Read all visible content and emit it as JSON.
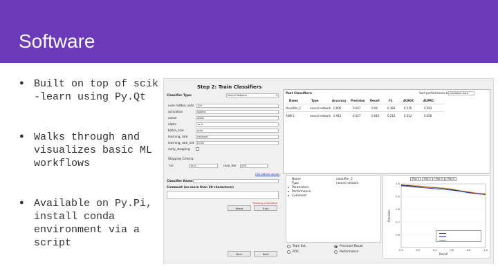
{
  "slide": {
    "title": "Software",
    "bullets": [
      "Built on top of scik\n-learn using Py.Qt",
      "Walks through and\nvisualizes basic ML\nworkflows",
      "Available on Py.Pi,\ninstall conda\nenvironment via a\nscript"
    ]
  },
  "app": {
    "step_title": "Step 2: Train Classifiers",
    "classifier_type_label": "Classifier Type:",
    "classifier_type_value": "Neural Network",
    "params": [
      {
        "label": "num hidden units",
        "value": "100"
      },
      {
        "label": "activation",
        "value": "logistic"
      },
      {
        "label": "solver",
        "value": "adam"
      },
      {
        "label": "alpha",
        "value": "1e-4"
      },
      {
        "label": "batch_size",
        "value": "auto"
      },
      {
        "label": "learning_rate",
        "value": "constant"
      },
      {
        "label": "learning_rate_init",
        "value": "0.001"
      },
      {
        "label": "early_stopping",
        "value": ""
      }
    ],
    "stopping_criteria_label": "Stopping Criteria:",
    "tol_label": "tol",
    "tol_value": "1e-4",
    "max_iter_label": "max_iter",
    "max_iter_value": "200",
    "use_defaults_link": "Use default values",
    "classifier_name_label": "Classifier Name:",
    "comment_label": "Comment (no more than 30 characters):",
    "training_status": "Training completed",
    "reset_label": "Reset",
    "train_label": "Train",
    "prev_label": "Back",
    "next_label": "Next",
    "past_classifiers_label": "Past Classifiers:",
    "sort_label": "Sort performance by:",
    "sort_value": "validation data",
    "table_columns": [
      "Name",
      "Type",
      "Accuracy",
      "Precision",
      "Recall",
      "F1",
      "AUROC",
      "AUPRC"
    ],
    "table_rows": [
      [
        "classifier_1",
        "neural network",
        "0.906",
        "0.047",
        "0.04",
        "0.364",
        "0.376",
        "0.563"
      ],
      [
        "ANN 1",
        "neural network",
        "0.912",
        "0.027",
        "0.014",
        "0.212",
        "0.312",
        "0.058"
      ]
    ],
    "info_lines": [
      {
        "key": "Name",
        "value": "classifier_2"
      },
      {
        "key": "Type",
        "value": "neural network"
      },
      {
        "key": "Parameters",
        "value": ""
      },
      {
        "key": "Performance",
        "value": ""
      },
      {
        "key": "Comment",
        "value": ""
      }
    ],
    "radio_options": [
      {
        "label": "Train Set",
        "checked": false
      },
      {
        "label": "Precision-Recall",
        "checked": true
      },
      {
        "label": "ROC",
        "checked": false
      },
      {
        "label": "Performance",
        "checked": false
      }
    ],
    "plot_tabs": [
      "Plot 1",
      "Plot 2",
      "Plot 3",
      "Plot 4"
    ]
  },
  "chart_data": {
    "type": "line",
    "title": "",
    "xlabel": "Recall",
    "ylabel": "Precision",
    "xlim": [
      0,
      1
    ],
    "ylim": [
      0.5,
      1.0
    ],
    "x_ticks": [
      "0.0",
      "0.2",
      "0.4",
      "0.6",
      "0.8",
      "1.0"
    ],
    "y_ticks": [
      "0.6",
      "0.7",
      "0.8",
      "0.9",
      "1.0"
    ],
    "series": [
      {
        "name": "",
        "color": "#1a1a1a",
        "x": [
          0,
          0.1,
          0.2,
          0.3,
          0.4,
          0.5,
          0.6,
          0.7,
          0.8,
          0.9,
          1.0
        ],
        "y": [
          0.99,
          0.985,
          0.98,
          0.975,
          0.97,
          0.965,
          0.955,
          0.945,
          0.935,
          0.925,
          0.92
        ]
      },
      {
        "name": "",
        "color": "#2a3fd6",
        "x": [
          0,
          0.1,
          0.2,
          0.3,
          0.4,
          0.5,
          0.6,
          0.7,
          0.8,
          0.9,
          1.0
        ],
        "y": [
          0.985,
          0.98,
          0.972,
          0.968,
          0.962,
          0.958,
          0.95,
          0.942,
          0.93,
          0.922,
          0.915
        ]
      },
      {
        "name": "",
        "color": "#e08a20",
        "x": [
          0,
          0.1,
          0.2,
          0.3,
          0.4,
          0.5,
          0.6,
          0.7,
          0.8,
          0.9,
          1.0
        ],
        "y": [
          0.995,
          0.99,
          0.984,
          0.978,
          0.973,
          0.968,
          0.96,
          0.948,
          0.938,
          0.928,
          0.922
        ]
      }
    ]
  }
}
